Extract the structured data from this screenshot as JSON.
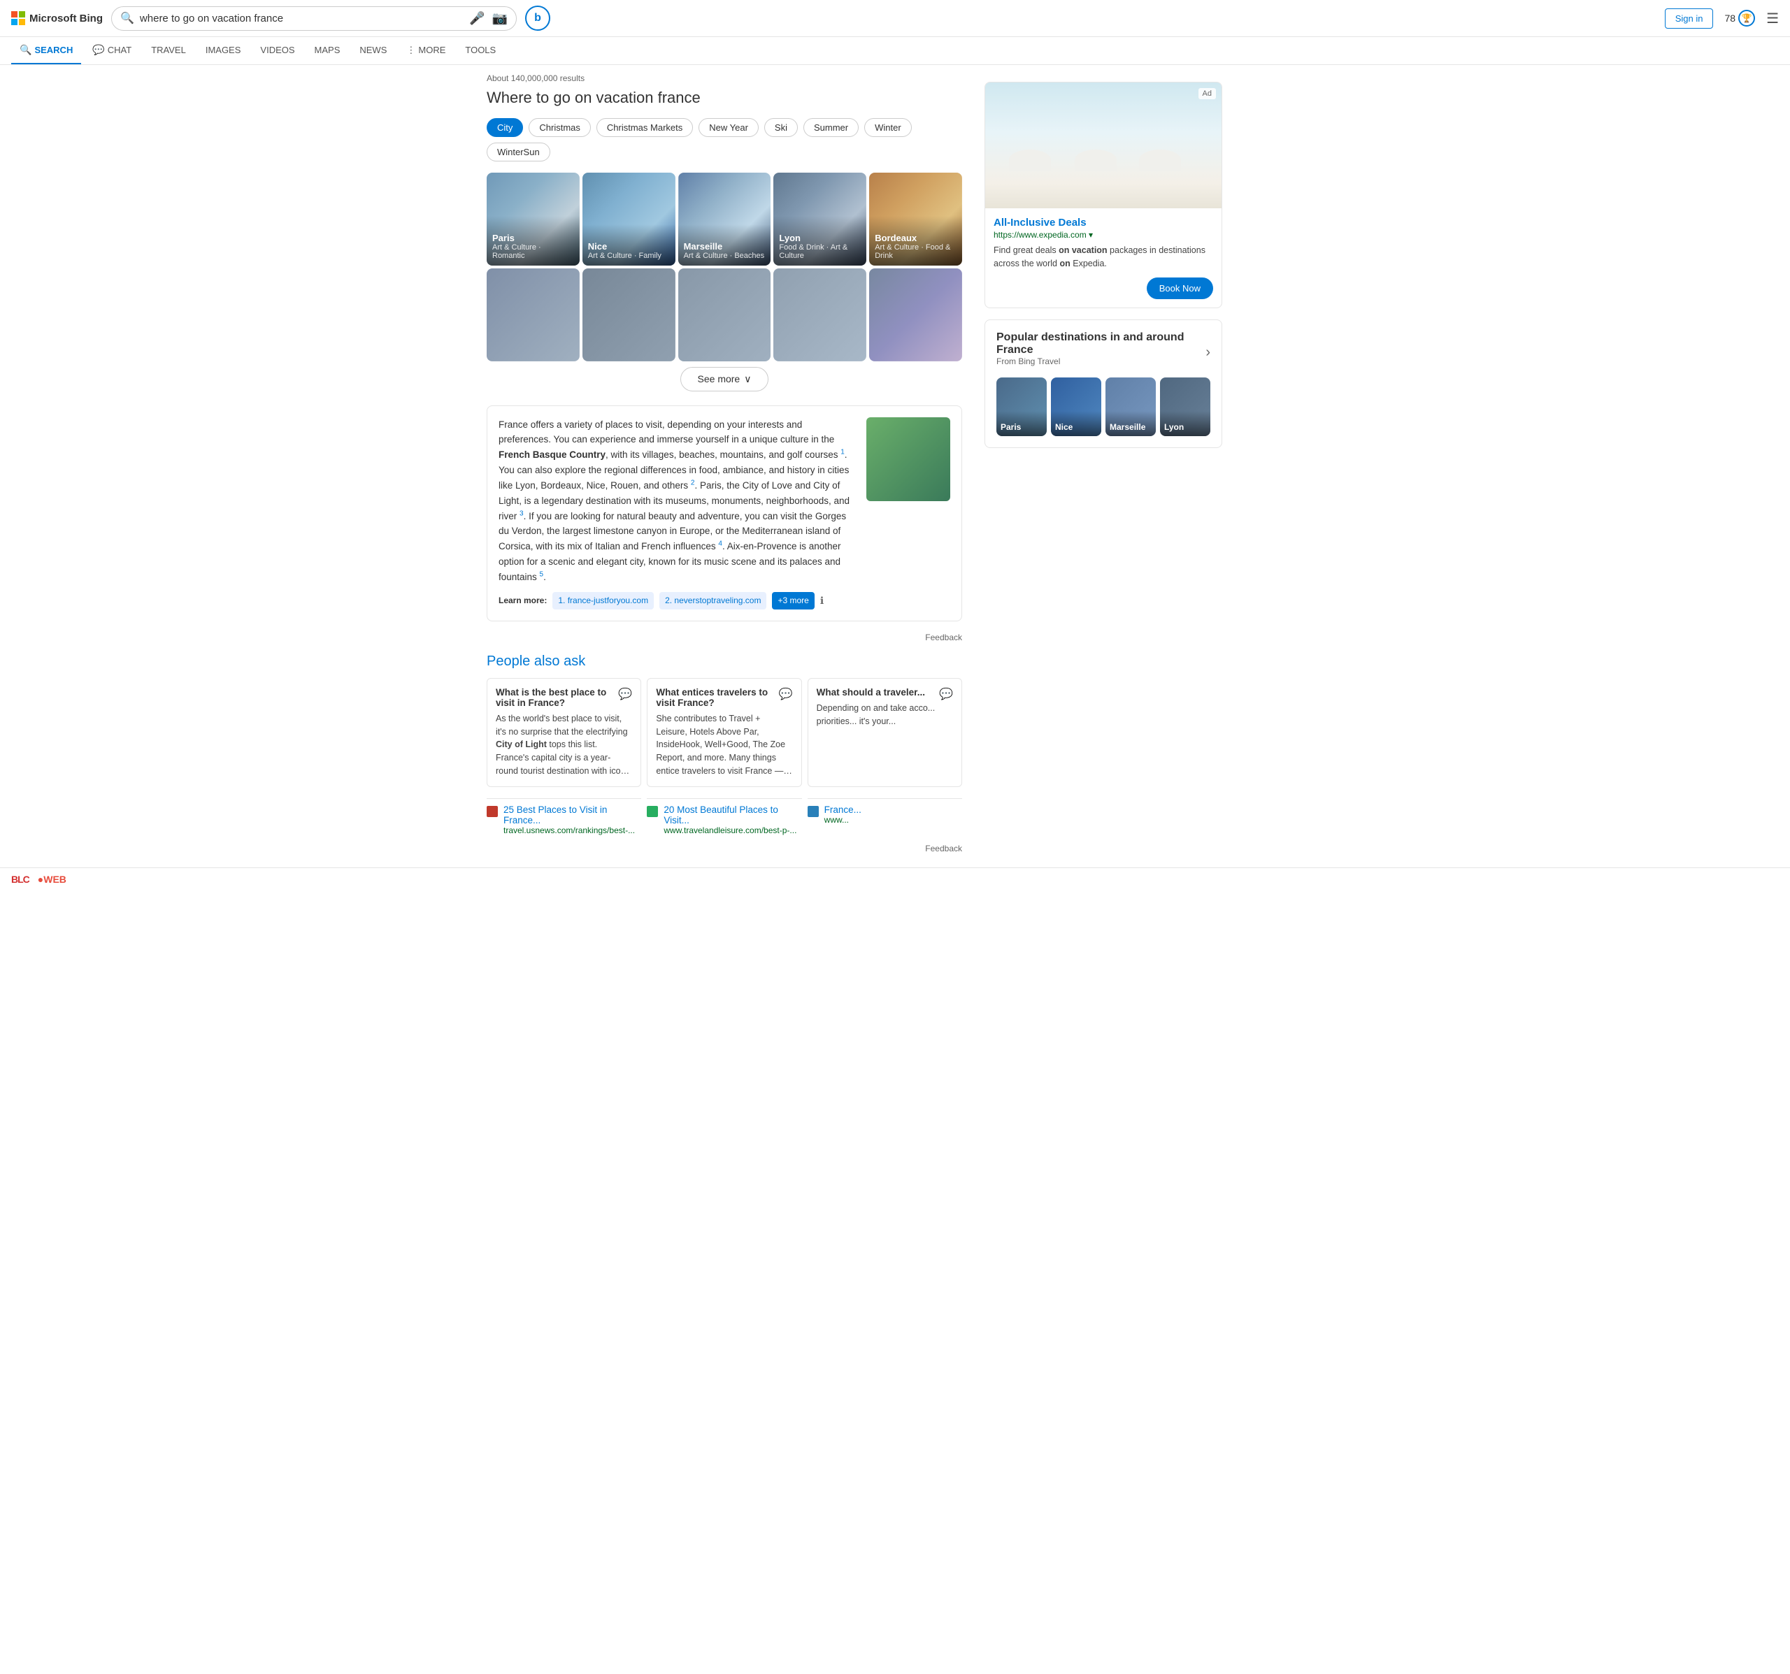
{
  "header": {
    "logo_text": "Microsoft Bing",
    "search_value": "where to go on vacation france",
    "sign_in": "Sign in",
    "points": "78",
    "chat_icon_label": "b"
  },
  "nav": {
    "items": [
      {
        "id": "search",
        "label": "SEARCH",
        "icon": "🔍",
        "active": true
      },
      {
        "id": "chat",
        "label": "CHAT",
        "icon": "💬",
        "active": false
      },
      {
        "id": "travel",
        "label": "TRAVEL",
        "icon": "",
        "active": false
      },
      {
        "id": "images",
        "label": "IMAGES",
        "icon": "",
        "active": false
      },
      {
        "id": "videos",
        "label": "VIDEOS",
        "icon": "",
        "active": false
      },
      {
        "id": "maps",
        "label": "MAPS",
        "icon": "",
        "active": false
      },
      {
        "id": "news",
        "label": "NEWS",
        "icon": "",
        "active": false
      },
      {
        "id": "more",
        "label": "MORE",
        "icon": "⋮",
        "active": false
      },
      {
        "id": "tools",
        "label": "TOOLS",
        "icon": "",
        "active": false
      }
    ]
  },
  "results": {
    "count_text": "About 140,000,000 results",
    "page_title": "Where to go on vacation france",
    "filters": [
      {
        "label": "City",
        "active": true
      },
      {
        "label": "Christmas",
        "active": false
      },
      {
        "label": "Christmas Markets",
        "active": false
      },
      {
        "label": "New Year",
        "active": false
      },
      {
        "label": "Ski",
        "active": false
      },
      {
        "label": "Summer",
        "active": false
      },
      {
        "label": "Winter",
        "active": false
      },
      {
        "label": "WinterSun",
        "active": false
      }
    ],
    "city_cards": [
      {
        "id": "paris",
        "title": "Paris",
        "subtitle": "Art & Culture · Romantic",
        "bg_class": "paris-bg"
      },
      {
        "id": "nice",
        "title": "Nice",
        "subtitle": "Art & Culture · Family",
        "bg_class": "nice-bg"
      },
      {
        "id": "marseille",
        "title": "Marseille",
        "subtitle": "Art & Culture · Beaches",
        "bg_class": "marseille-bg"
      },
      {
        "id": "lyon",
        "title": "Lyon",
        "subtitle": "Food & Drink · Art & Culture",
        "bg_class": "lyon-bg"
      },
      {
        "id": "bordeaux",
        "title": "Bordeaux",
        "subtitle": "Art & Culture · Food & Drink",
        "bg_class": "bordeaux-bg"
      }
    ],
    "row2_cards": [
      {
        "id": "r2-1",
        "bg_class": "row2-1"
      },
      {
        "id": "r2-2",
        "bg_class": "row2-2"
      },
      {
        "id": "r2-3",
        "bg_class": "row2-3"
      },
      {
        "id": "r2-4",
        "bg_class": "row2-4"
      },
      {
        "id": "r2-5",
        "bg_class": "row2-5"
      }
    ],
    "see_more_label": "See more",
    "description": "France offers a variety of places to visit, depending on your interests and preferences. You can experience and immerse yourself in a unique culture in the French Basque Country, with its villages, beaches, mountains, and golf courses",
    "description_2": ". You can also explore the regional differences in food, ambiance, and history in cities like Lyon, Bordeaux, Nice, Rouen, and others",
    "description_3": ". Paris, the City of Love and City of Light, is a legendary destination with its museums, monuments, neighborhoods, and river",
    "description_4": ". If you are looking for natural beauty and adventure, you can visit the Gorges du Verdon, the largest limestone canyon in Europe, or the Mediterranean island of Corsica, with its mix of Italian and French influences",
    "description_5": ". Aix-en-Provence is another option for a scenic and elegant city, known for its music scene and its palaces and fountains",
    "learn_more_label": "Learn more:",
    "learn_more_links": [
      {
        "label": "1. france-justforyou.com"
      },
      {
        "label": "2. neverstoptraveling.com"
      },
      {
        "label": "+3 more"
      }
    ],
    "feedback_label": "Feedback"
  },
  "paa": {
    "title": "People also ask",
    "questions": [
      {
        "q": "What is the best place to visit in France?",
        "a": "As the world's best place to visit, it's no surprise that the electrifying City of Light tops this list. France's capital city is a year-round tourist destination with iconic attractions like the Louvre and..."
      },
      {
        "q": "What entices travelers to visit France?",
        "a": "She contributes to Travel + Leisure, Hotels Above Par, InsideHook, Well+Good, The Zoe Report, and more. Many things entice travelers to visit France — food, wine, fashion,..."
      },
      {
        "q": "What should a traveler...",
        "a": "Depending on and take acco... priorities... it's your..."
      }
    ]
  },
  "bottom_results": [
    {
      "title": "25 Best Places to Visit in France...",
      "url": "travel.usnews.com/rankings/best-..."
    },
    {
      "title": "20 Most Beautiful Places to Visit...",
      "url": "www.travelandleisure.com/best-p-..."
    },
    {
      "title": "France...",
      "url": "www..."
    }
  ],
  "ad": {
    "badge": "Ad",
    "title": "All-Inclusive Deals",
    "url": "https://www.expedia.com",
    "url_label": "https://www.expedia.com ▾",
    "description": "Find great deals on vacation packages in destinations across the world on Expedia.",
    "cta_label": "Book Now"
  },
  "popular_destinations": {
    "title": "Popular destinations in and around France",
    "subtitle": "From Bing Travel",
    "items": [
      {
        "label": "Paris",
        "bg_class": "thumb-paris"
      },
      {
        "label": "Nice",
        "bg_class": "thumb-nice"
      },
      {
        "label": "Marseille",
        "bg_class": "thumb-marseille"
      },
      {
        "label": "Lyon",
        "bg_class": "thumb-lyon"
      }
    ]
  }
}
